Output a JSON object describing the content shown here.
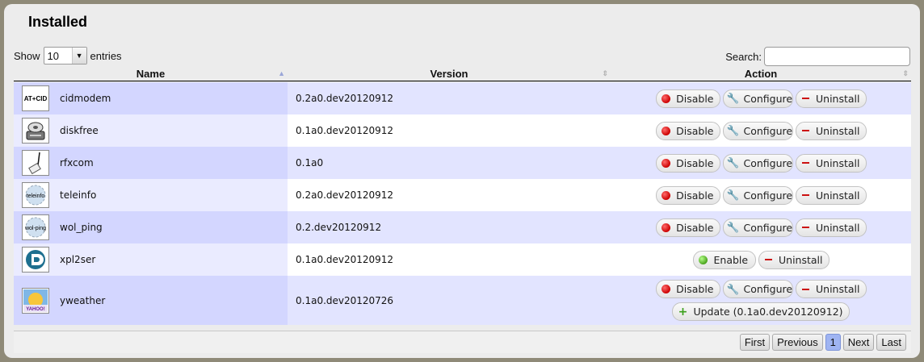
{
  "panel": {
    "title": "Installed"
  },
  "length": {
    "show_label": "Show",
    "selected": "10",
    "entries_label": "entries"
  },
  "search": {
    "label": "Search:",
    "value": ""
  },
  "columns": {
    "name": "Name",
    "version": "Version",
    "action": "Action"
  },
  "actions": {
    "disable": "Disable",
    "configure": "Configure",
    "uninstall": "Uninstall",
    "enable": "Enable",
    "update": "Update (0.1a0.dev20120912)"
  },
  "rows": [
    {
      "name": "cidmodem",
      "version": "0.2a0.dev20120912",
      "icon": "cidmodem-icon",
      "icon_text": "AT+CID"
    },
    {
      "name": "diskfree",
      "version": "0.1a0.dev20120912",
      "icon": "hard-disk-icon"
    },
    {
      "name": "rfxcom",
      "version": "0.1a0",
      "icon": "usb-device-icon"
    },
    {
      "name": "teleinfo",
      "version": "0.2a0.dev20120912",
      "icon": "teleinfo-icon",
      "icon_text": "teleinfo"
    },
    {
      "name": "wol_ping",
      "version": "0.2.dev20120912",
      "icon": "wol-ping-icon",
      "icon_text": "wol-ping"
    },
    {
      "name": "xpl2ser",
      "version": "0.1a0.dev20120912",
      "icon": "xpl-logo-icon"
    },
    {
      "name": "yweather",
      "version": "0.1a0.dev20120726",
      "icon": "yahoo-weather-icon",
      "icon_text": "YAHOO!"
    }
  ],
  "pagination": {
    "first": "First",
    "previous": "Previous",
    "current": "1",
    "next": "Next",
    "last": "Last"
  },
  "colors": {
    "row_odd": "#e2e4ff",
    "row_odd_sorted": "#d3d6ff",
    "row_even": "#ffffff",
    "row_even_sorted": "#eaebff",
    "current_page": "#9fb4f2"
  }
}
